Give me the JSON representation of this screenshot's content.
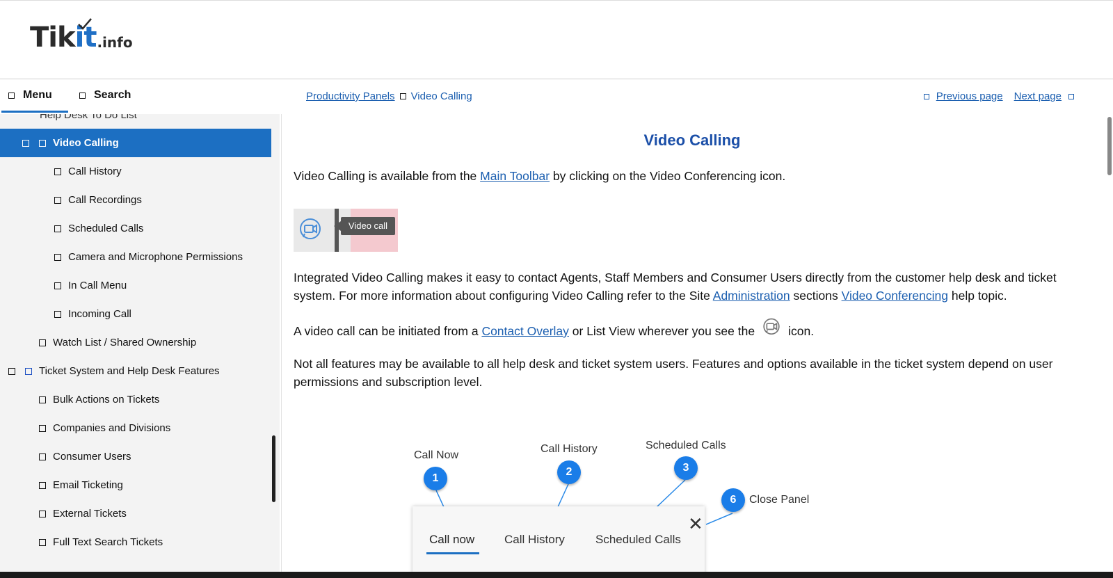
{
  "logo": {
    "main_text_a": "Tik",
    "main_text_b": "it",
    "sub_text": ".info"
  },
  "nav": {
    "menu_label": "Menu",
    "search_label": "Search"
  },
  "sidebar": {
    "partial_item": "Help Desk To Do List",
    "items": [
      {
        "label": "Video Calling",
        "active": true
      },
      {
        "label": "Call History"
      },
      {
        "label": "Call Recordings"
      },
      {
        "label": "Scheduled Calls"
      },
      {
        "label": "Camera and Microphone Permissions"
      },
      {
        "label": "In Call Menu"
      },
      {
        "label": "Incoming Call"
      },
      {
        "label": "Watch List / Shared Ownership"
      },
      {
        "label": "Ticket System and Help Desk Features"
      },
      {
        "label": "Bulk Actions on Tickets"
      },
      {
        "label": "Companies and Divisions"
      },
      {
        "label": "Consumer Users"
      },
      {
        "label": "Email Ticketing"
      },
      {
        "label": "External Tickets"
      },
      {
        "label": "Full Text Search Tickets"
      }
    ]
  },
  "breadcrumb": {
    "parent": "Productivity Panels",
    "current": "Video Calling"
  },
  "pager": {
    "prev": "Previous page",
    "next": "Next page"
  },
  "content": {
    "title": "Video Calling",
    "p1_a": "Video Calling is available from the ",
    "p1_link": "Main Toolbar",
    "p1_b": " by clicking on the Video Conferencing icon.",
    "tooltip": "Video call",
    "p2_a": "Integrated Video Calling makes it easy to contact Agents, Staff Members and Consumer Users directly from the customer help desk and ticket system.  For more information about configuring Video Calling refer to the Site ",
    "p2_link1": "Administration",
    "p2_b": " sections ",
    "p2_link2": "Video Conferencing",
    "p2_c": " help topic.",
    "p3_a": "A video call can be initiated from a ",
    "p3_link": "Contact Overlay",
    "p3_b": " or List View  wherever you see the",
    "p3_c": "icon.",
    "p4": "Not all features may be available to all help desk and ticket system users.  Features and options available in the ticket system depend on user permissions and subscription level."
  },
  "diagram": {
    "callouts": [
      {
        "num": "1",
        "label": "Call Now"
      },
      {
        "num": "2",
        "label": "Call History"
      },
      {
        "num": "3",
        "label": "Scheduled Calls"
      },
      {
        "num": "6",
        "label": "Close Panel"
      }
    ],
    "tabs": [
      "Call now",
      "Call History",
      "Scheduled Calls"
    ]
  },
  "colors": {
    "accent": "#1c6fc2",
    "link": "#1c5fb0",
    "title": "#1b4fa8",
    "badge": "#1a7de8"
  }
}
